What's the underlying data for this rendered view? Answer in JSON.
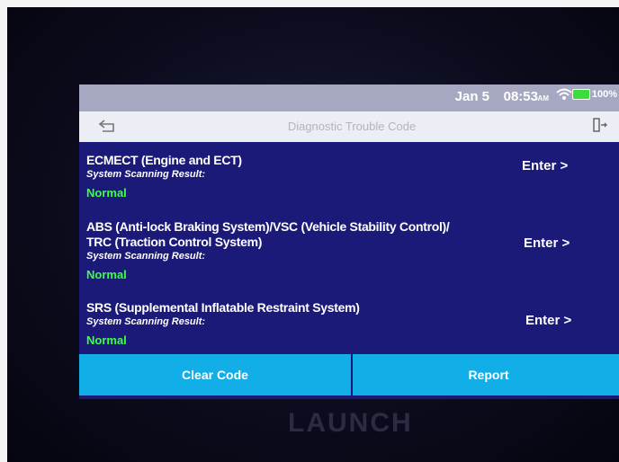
{
  "status_bar": {
    "date": "Jan 5",
    "time": "08:53",
    "ampm": "AM",
    "battery": "100%"
  },
  "header": {
    "title": "Diagnostic Trouble Code"
  },
  "systems": [
    {
      "name": "ECMECT (Engine and ECT)",
      "scan_label": "System Scanning Result:",
      "result": "Normal",
      "enter_label": "Enter >"
    },
    {
      "name": "ABS (Anti-lock Braking System)/VSC (Vehicle Stability Control)/",
      "name_line2": "TRC (Traction Control System)",
      "scan_label": "System Scanning Result:",
      "result": "Normal",
      "enter_label": "Enter >"
    },
    {
      "name": "SRS (Supplemental Inflatable Restraint System)",
      "scan_label": "System Scanning Result:",
      "result": "Normal",
      "enter_label": "Enter >"
    }
  ],
  "buttons": {
    "clear_code": "Clear Code",
    "report": "Report"
  },
  "brand": "LAUNCH",
  "colors": {
    "screen_bg": "#1b1a78",
    "result_green": "#3cff46",
    "button_blue": "#12aee8"
  }
}
